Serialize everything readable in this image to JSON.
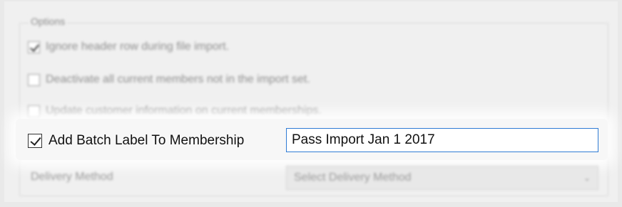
{
  "options": {
    "group_title": "Options",
    "checkboxes": [
      {
        "label": "Ignore header row during file import.",
        "checked": true
      },
      {
        "label": "Deactivate all current members not in the import set.",
        "checked": false
      },
      {
        "label": "Update customer information on current memberships.",
        "checked": false
      },
      {
        "label": "Add Batch Label To Membership",
        "checked": true
      }
    ],
    "batch_label": {
      "value": "Pass Import Jan 1 2017"
    },
    "delivery": {
      "label": "Delivery Method",
      "selected": "Select Delivery Method",
      "chevron_icon": "chevron-down-icon"
    }
  },
  "colors": {
    "focus_border": "#2f7bd4",
    "panel_bg": "#f0f0f0"
  }
}
